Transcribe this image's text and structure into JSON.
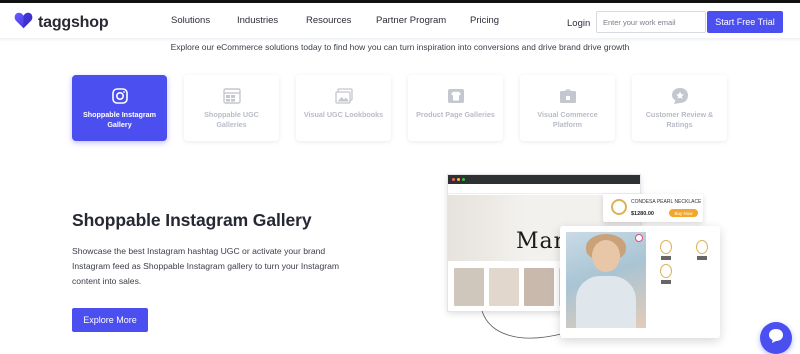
{
  "header": {
    "logo_text": "taggshop",
    "nav": [
      "Solutions",
      "Industries",
      "Resources",
      "Partner Program",
      "Pricing"
    ],
    "login_label": "Login",
    "email_placeholder": "Enter your work email",
    "trial_label": "Start Free Trial"
  },
  "tagline": "Explore our eCommerce solutions today to find how you can turn inspiration into conversions and drive brand drive growth",
  "cards": [
    {
      "label": "Shoppable Instagram Gallery",
      "icon": "instagram-icon",
      "active": true
    },
    {
      "label": "Shoppable UGC Galleries",
      "icon": "gallery-grid-icon",
      "active": false
    },
    {
      "label": "Visual UGC Lookbooks",
      "icon": "image-icon",
      "active": false
    },
    {
      "label": "Product Page Galleries",
      "icon": "shirt-icon",
      "active": false
    },
    {
      "label": "Visual Commerce Platform",
      "icon": "shopping-bag-icon",
      "active": false
    },
    {
      "label": "Customer Review & Ratings",
      "icon": "review-star-icon",
      "active": false
    }
  ],
  "section": {
    "title": "Shoppable Instagram Gallery",
    "description": "Showcase the best Instagram hashtag UGC or activate your brand Instagram feed as Shoppable Instagram gallery to turn your Instagram content into sales.",
    "cta_label": "Explore More"
  },
  "illustration": {
    "hero_word": "Mam",
    "product_name": "CONDESA PEARL NECKLACE",
    "product_price": "$1280.00",
    "buy_label": "Buy Now"
  },
  "colors": {
    "accent": "#4c4ff0",
    "buy_button": "#f4a62a",
    "card_label_muted": "#b9bcc7"
  }
}
